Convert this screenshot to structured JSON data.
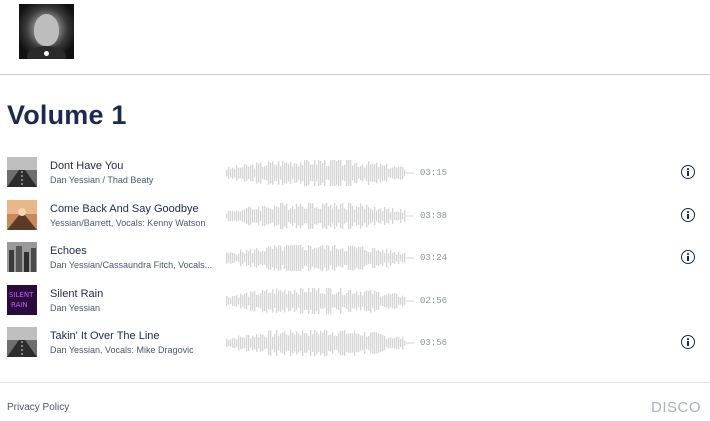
{
  "header": {
    "avatar_alt": "profile photo"
  },
  "page": {
    "title": "Volume 1"
  },
  "tracks": [
    {
      "name": "Dont Have You",
      "artist": "Dan Yessian / Thad Beaty",
      "duration": "03:15",
      "has_info": true,
      "art": "road-bw"
    },
    {
      "name": "Come Back And Say Goodbye",
      "artist": "Yessian/Barrett, Vocals: Kenny Watson",
      "duration": "03:38",
      "has_info": true,
      "art": "sunset-road"
    },
    {
      "name": "Echoes",
      "artist": "Dan Yessian/Cassaundra Fitch, Vocals...",
      "duration": "03:24",
      "has_info": true,
      "art": "city-bw"
    },
    {
      "name": "Silent Rain",
      "artist": "Dan Yessian",
      "duration": "02:56",
      "has_info": false,
      "art": "neon-text"
    },
    {
      "name": "Takin' It Over The Line",
      "artist": "Dan Yessian, Vocals: Mike Dragovic",
      "duration": "03:56",
      "has_info": true,
      "art": "road-bw"
    }
  ],
  "footer": {
    "privacy_label": "Privacy Policy",
    "brand": "DISCO"
  },
  "colors": {
    "title": "#1b2a4e",
    "waveform": "#d4d4d4",
    "muted": "#8a93a3"
  },
  "icons": {
    "info": "info-circle-icon"
  }
}
